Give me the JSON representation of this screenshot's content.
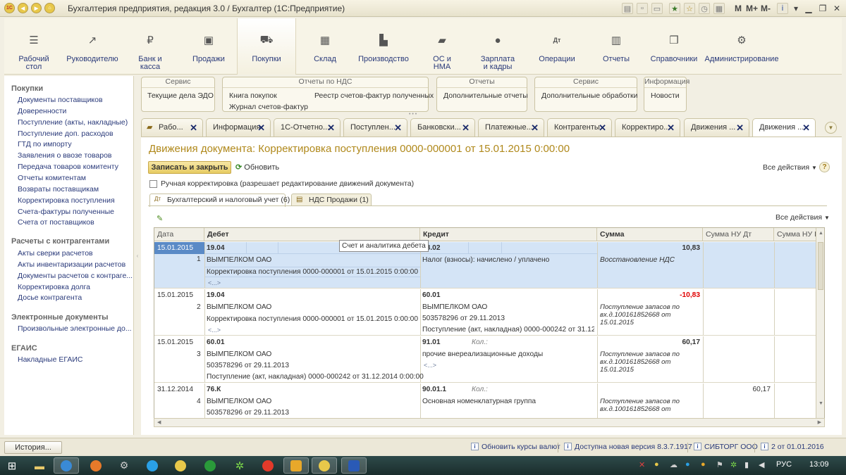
{
  "window": {
    "title": "Бухгалтерия предприятия, редакция 3.0 / Бухгалтер  (1С:Предприятие)",
    "m_buttons": [
      "M",
      "M+",
      "M-"
    ]
  },
  "sections": [
    {
      "label": "Рабочий стол",
      "icon": "list-icon"
    },
    {
      "label": "Руководителю",
      "icon": "trend-icon"
    },
    {
      "label": "Банк и касса",
      "icon": "ruble-icon"
    },
    {
      "label": "Продажи",
      "icon": "bag-icon"
    },
    {
      "label": "Покупки",
      "icon": "cart-icon"
    },
    {
      "label": "Склад",
      "icon": "grid-icon"
    },
    {
      "label": "Производство",
      "icon": "factory-icon"
    },
    {
      "label": "ОС и НМА",
      "icon": "truck-icon"
    },
    {
      "label": "Зарплата и кадры",
      "icon": "person-icon"
    },
    {
      "label": "Операции",
      "icon": "dt-kt-icon"
    },
    {
      "label": "Отчеты",
      "icon": "bar-chart-icon"
    },
    {
      "label": "Справочники",
      "icon": "book-icon"
    },
    {
      "label": "Администрирование",
      "icon": "gear-icon"
    }
  ],
  "active_section": "Покупки",
  "nav": {
    "groups": [
      {
        "title": "Покупки",
        "items": [
          "Документы поставщиков",
          "Доверенности",
          "Поступление (акты, накладные)",
          "Поступление доп. расходов",
          "ГТД по импорту",
          "Заявления о ввозе товаров",
          "Передача товаров комитенту",
          "Отчеты комитентам",
          "Возвраты поставщикам",
          "Корректировка поступления",
          "Счета-фактуры полученные",
          "Счета от поставщиков"
        ]
      },
      {
        "title": "Расчеты с контрагентами",
        "items": [
          "Акты сверки расчетов",
          "Акты инвентаризации расчетов",
          "Документы расчетов с контраге...",
          "Корректировка долга",
          "Досье контрагента"
        ]
      },
      {
        "title": "Электронные документы",
        "items": [
          "Произвольные электронные до..."
        ]
      },
      {
        "title": "ЕГАИС",
        "items": [
          "Накладные ЕГАИС"
        ]
      }
    ]
  },
  "command_groups": [
    {
      "title": "Сервис",
      "items": [
        "Текущие дела ЭДО"
      ]
    },
    {
      "title": "Отчеты по НДС",
      "items": [
        "Книга покупок",
        "Журнал счетов-фактур",
        "Реестр счетов-фактур полученных"
      ]
    },
    {
      "title": "Отчеты",
      "items": [
        "Дополнительные отчеты"
      ]
    },
    {
      "title": "Сервис",
      "items": [
        "Дополнительные обработки"
      ]
    },
    {
      "title": "Информация",
      "items": [
        "Новости"
      ]
    }
  ],
  "tabs": [
    {
      "label": "Рабо..."
    },
    {
      "label": "Информация"
    },
    {
      "label": "1С-Отчетно..."
    },
    {
      "label": "Поступлен..."
    },
    {
      "label": "Банковски..."
    },
    {
      "label": "Платежные..."
    },
    {
      "label": "Контрагенты"
    },
    {
      "label": "Корректиро..."
    },
    {
      "label": "Движения ..."
    },
    {
      "label": "Движения ..."
    }
  ],
  "document": {
    "title": "Движения документа: Корректировка поступления 0000-000001 от 15.01.2015 0:00:00",
    "save_close": "Записать и закрыть",
    "refresh": "Обновить",
    "all_actions": "Все действия",
    "manual_edit": "Ручная корректировка (разрешает редактирование движений документа)",
    "manual_edit_checked": false,
    "inner_tabs": [
      "Бухгалтерский и налоговый учет (6)",
      "НДС Продажи (1)"
    ],
    "inner_all_actions": "Все действия",
    "tooltip": "Счет и аналитика дебета"
  },
  "grid": {
    "headers": [
      "Дата",
      "Дебет",
      "Кредит",
      "Сумма",
      "Сумма НУ Дт",
      "Сумма НУ К"
    ],
    "rows": [
      {
        "date": "15.01.2015",
        "n": "1",
        "debit_account": "19.04",
        "debit_lines": [
          "ВЫМПЕЛКОМ ОАО",
          "Корректировка поступления 0000-000001 от 15.01.2015 0:00:00",
          "<...>"
        ],
        "credit_account": "68.02",
        "credit_qty": "",
        "credit_lines": [
          "Налог (взносы): начислено / уплачено"
        ],
        "amount": "10,83",
        "amount_negative": false,
        "content_lines": [
          "Восстановление НДС"
        ],
        "nu_dt": "",
        "selected": true
      },
      {
        "date": "15.01.2015",
        "n": "2",
        "debit_account": "19.04",
        "debit_lines": [
          "ВЫМПЕЛКОМ ОАО",
          "Корректировка поступления 0000-000001 от 15.01.2015 0:00:00",
          "<...>"
        ],
        "credit_account": "60.01",
        "credit_qty": "",
        "credit_lines": [
          "ВЫМПЕЛКОМ ОАО",
          "503578296 от 29.11.2013",
          "Поступление (акт, накладная) 0000-000242 от 31.12...."
        ],
        "amount": "-10,83",
        "amount_negative": true,
        "content_lines": [
          "Поступление запасов по",
          "вх.д.100161852668 от",
          "15.01.2015"
        ],
        "nu_dt": "",
        "selected": false
      },
      {
        "date": "15.01.2015",
        "n": "3",
        "debit_account": "60.01",
        "debit_lines": [
          "ВЫМПЕЛКОМ ОАО",
          "503578296 от 29.11.2013",
          "Поступление (акт, накладная) 0000-000242 от 31.12.2014 0:00:00"
        ],
        "credit_account": "91.01",
        "credit_qty": "Кол.:",
        "credit_lines": [
          "прочие внереализационные доходы",
          "<...>"
        ],
        "amount": "60,17",
        "amount_negative": false,
        "content_lines": [
          "Поступление запасов по",
          "вх.д.100161852668 от",
          "15.01.2015"
        ],
        "nu_dt": "",
        "selected": false
      },
      {
        "date": "31.12.2014",
        "n": "4",
        "debit_account": "76.К",
        "debit_lines": [
          "ВЫМПЕЛКОМ ОАО",
          "503578296 от 29.11.2013"
        ],
        "credit_account": "90.01.1",
        "credit_qty": "Кол.:",
        "credit_lines": [
          "Основная номенклатурная группа"
        ],
        "amount": "",
        "amount_negative": false,
        "content_lines": [
          "Поступление запасов по",
          "вх.д.100161852668 от"
        ],
        "nu_dt": "60,17",
        "selected": false
      }
    ]
  },
  "statusbar": {
    "history": "История...",
    "items": [
      "Обновить курсы валют",
      "Доступна новая версия 8.3.7.1917",
      "СИБТОРГ ООО",
      "2 от 01.01.2016"
    ]
  },
  "taskbar": {
    "lang": "РУС",
    "time": "13:09"
  },
  "colors": {
    "accent_title": "#b0891c",
    "selection": "#d4e4f6",
    "negative": "#e00000",
    "link": "#2a3a7a"
  }
}
